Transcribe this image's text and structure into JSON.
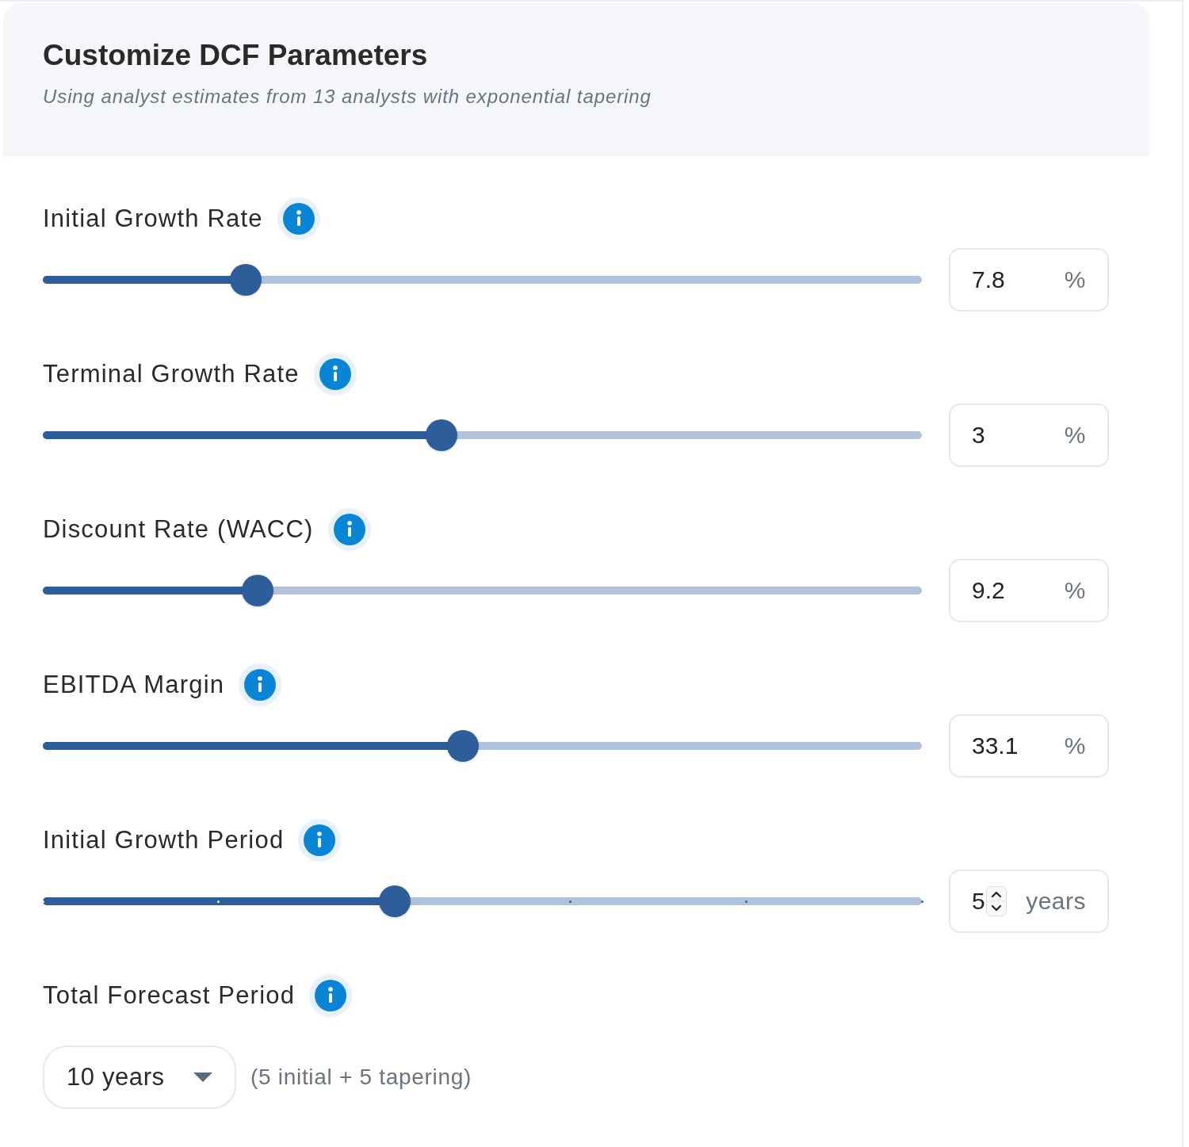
{
  "header": {
    "title": "Customize DCF Parameters",
    "subtitle": "Using analyst estimates from 13 analysts with exponential tapering"
  },
  "parameters": [
    {
      "kind": "slider",
      "label": "Initial Growth Rate",
      "level": 0.231,
      "value": "7.8",
      "unit": "%"
    },
    {
      "kind": "slider",
      "label": "Terminal Growth Rate",
      "level": 0.454,
      "value": "3",
      "unit": "%"
    },
    {
      "kind": "slider",
      "label": "Discount Rate (WACC)",
      "level": 0.244,
      "value": "9.2",
      "unit": "%"
    },
    {
      "kind": "slider",
      "label": "EBITDA Margin",
      "level": 0.478,
      "value": "33.1",
      "unit": "%"
    },
    {
      "kind": "stepped",
      "label": "Initial Growth Period",
      "level": 0.4,
      "value": "5",
      "unit": "years",
      "marks": [
        {
          "level": 0
        },
        {
          "level": 0.2
        },
        {
          "level": 0.4
        },
        {
          "level": 0.6
        },
        {
          "level": 0.8
        },
        {
          "level": 1
        }
      ]
    },
    {
      "kind": "select",
      "label": "Total Forecast Period",
      "value": "10 years",
      "note": "(5 initial + 5 tapering)"
    }
  ]
}
